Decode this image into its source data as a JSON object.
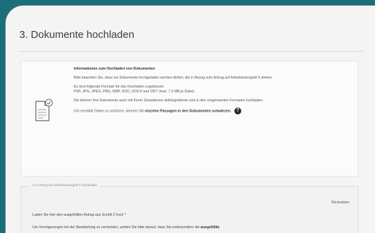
{
  "page": {
    "title": "3. Dokumente hochladen"
  },
  "info": {
    "heading": "Informationen zum Hochladen von Dokumenten",
    "para1": "Bitte beachten Sie, dass nur Dokumente hochgeladen werden dürfen, die in Bezug zum Antrag auf Arbeitslosengeld II stehen.",
    "para2_line1": "Es sind folgende Formate für das Hochladen zugelassen:",
    "para2_line2": "PDF, JPG, JPEG, PNG, BMP, DOC, DOCX und ODT (max. 7,5 MB je Datei).",
    "para3": "Sie können Ihre Dokumente auch mit Ihrem Smartphone abfotografieren und in den vorgenannten Formaten hochladen.",
    "para4_prefix": "Um sensible Daten zu schützen, können Sie",
    "para4_bold": "einzelne Passagen in den Dokumenten schwärzen.",
    "help_glyph": "?"
  },
  "section": {
    "legend": "3.1 Antrag auf Arbeitslosengeld II hochladen",
    "clear_label": "Rücksetzen",
    "upload_label": "Laden Sie hier den ausgefüllten Antrag aus Schritt 2 hoch *",
    "hint_prefix": "Um Verzögerungen bei der Bearbeitung zu vermeiden, achten Sie bitte darauf, dass Sie insbesondere die",
    "hint_bold": "ausgefüllte"
  },
  "colors": {
    "frame": "#1b6f79",
    "card": "#f4f4f4",
    "help_icon": "#1f2b3a"
  }
}
